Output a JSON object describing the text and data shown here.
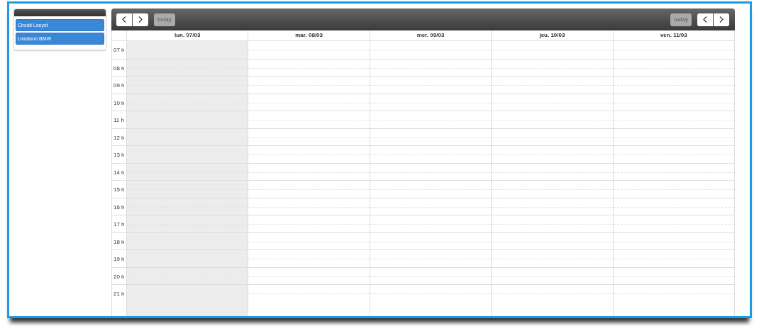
{
  "sidebar": {
    "items": [
      {
        "label": "Circuit Louyet"
      },
      {
        "label": "Livraison BMW"
      }
    ]
  },
  "toolbar": {
    "left": {
      "today": {
        "label": "today",
        "disabled": true
      }
    },
    "right": {
      "today": {
        "label": "today",
        "disabled": true
      }
    }
  },
  "days": [
    {
      "label": "lun. 07/03",
      "today": true
    },
    {
      "label": "mar. 08/03",
      "today": false
    },
    {
      "label": "mer. 09/03",
      "today": false
    },
    {
      "label": "jeu. 10/03",
      "today": false
    },
    {
      "label": "ven. 11/03",
      "today": false
    }
  ],
  "hours": [
    "07 h",
    "08 h",
    "09 h",
    "10 h",
    "11 h",
    "12 h",
    "13 h",
    "14 h",
    "15 h",
    "16 h",
    "17 h",
    "18 h",
    "19 h",
    "20 h",
    "21 h"
  ]
}
